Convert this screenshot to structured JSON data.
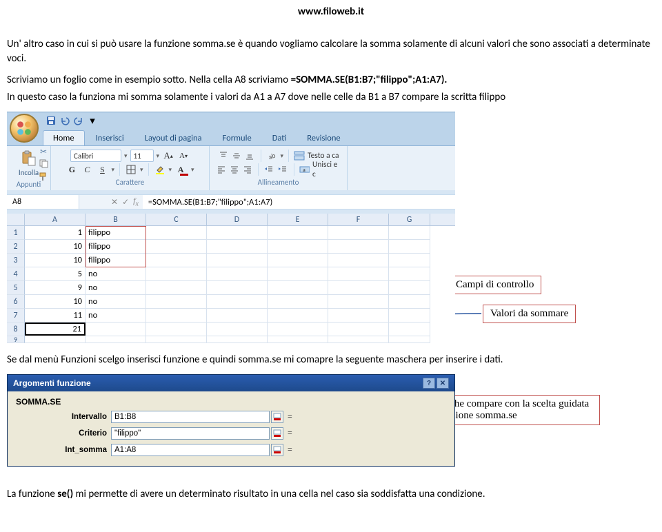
{
  "url": "www.filoweb.it",
  "intro_p1": "Un' altro caso in cui si può usare la funzione somma.se è quando vogliamo calcolare la somma solamente di alcuni valori che sono associati a determinate voci.",
  "intro_p2_a": "Scriviamo un foglio come in esempio sotto. Nella cella A8 scriviamo ",
  "intro_p2_b": "=SOMMA.SE(B1:B7;\"filippo\";A1:A7).",
  "intro_p3": "In questo caso la funziona mi somma solamente i valori da A1 a A7 dove nelle celle da B1 a B7 compare la scritta filippo",
  "tabs": [
    "Home",
    "Inserisci",
    "Layout di pagina",
    "Formule",
    "Dati",
    "Revisione"
  ],
  "ribbon": {
    "paste": "Incolla",
    "clipboard_grp": "Appunti",
    "font_name": "Calibri",
    "font_size": "11",
    "font_grp": "Carattere",
    "align_grp": "Allineamento",
    "wrap_text": "Testo a ca",
    "merge": "Unisci e c"
  },
  "namebox": "A8",
  "formula": "=SOMMA.SE(B1:B7;\"filippo\";A1:A7)",
  "cols": [
    "A",
    "B",
    "C",
    "D",
    "E",
    "F",
    "G"
  ],
  "rows": [
    {
      "n": "1",
      "a": "1",
      "b": "filippo"
    },
    {
      "n": "2",
      "a": "10",
      "b": "filippo"
    },
    {
      "n": "3",
      "a": "10",
      "b": "filippo"
    },
    {
      "n": "4",
      "a": "5",
      "b": "no"
    },
    {
      "n": "5",
      "a": "9",
      "b": "no"
    },
    {
      "n": "6",
      "a": "10",
      "b": "no"
    },
    {
      "n": "7",
      "a": "11",
      "b": "no"
    },
    {
      "n": "8",
      "a": "21",
      "b": ""
    }
  ],
  "callout1": "Campi di controllo",
  "callout2": "Valori da sommare",
  "mid_para": "Se dal menù Funzioni scelgo inserisci funzione e quindi somma.se mi comapre la seguente maschera per inserire i dati.",
  "dlg": {
    "title": "Argomenti funzione",
    "fn": "SOMMA.SE",
    "labels": [
      "Intervallo",
      "Criterio",
      "Int_somma"
    ],
    "vals": [
      "B1:B8",
      "\"filippo\"",
      "A1:A8"
    ]
  },
  "callout3": "Schema che compare con la scelta guidata della funzione somma.se",
  "final_p_a": "La funzione ",
  "final_p_b": "se()",
  "final_p_c": " mi permette di avere un determinato risultato in una cella nel caso sia soddisfatta una condizione."
}
